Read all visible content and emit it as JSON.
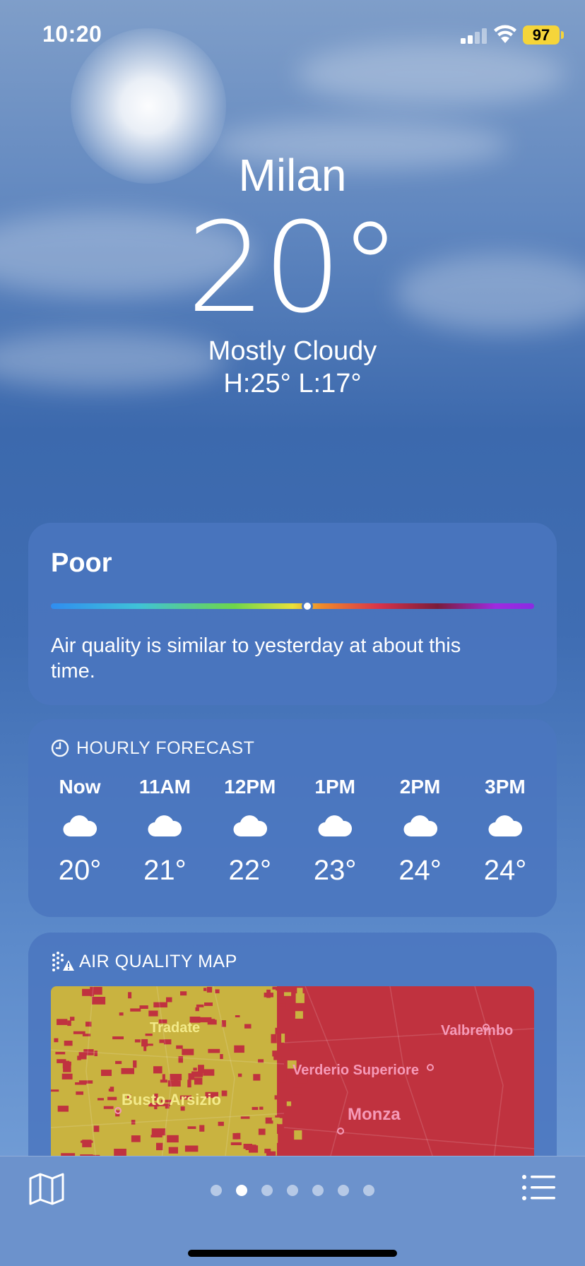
{
  "status_bar": {
    "time": "10:20",
    "battery": "97"
  },
  "hero": {
    "city": "Milan",
    "temperature": "20°",
    "condition": "Mostly Cloudy",
    "high_low": "H:25°  L:17°"
  },
  "air_quality": {
    "category": "Poor",
    "level_fraction": 0.53,
    "description": "Air quality is similar to yesterday at about this time."
  },
  "hourly_forecast": {
    "header": "HOURLY FORECAST",
    "icon": "clock-icon",
    "hours": [
      {
        "time": "Now",
        "icon": "cloud-icon",
        "temp": "20°"
      },
      {
        "time": "11AM",
        "icon": "cloud-icon",
        "temp": "21°"
      },
      {
        "time": "12PM",
        "icon": "cloud-icon",
        "temp": "22°"
      },
      {
        "time": "1PM",
        "icon": "cloud-icon",
        "temp": "23°"
      },
      {
        "time": "2PM",
        "icon": "cloud-icon",
        "temp": "24°"
      },
      {
        "time": "3PM",
        "icon": "cloud-icon",
        "temp": "24°"
      }
    ]
  },
  "air_quality_map": {
    "header": "AIR QUALITY MAP",
    "icon": "air-quality-warning-icon",
    "places": [
      "Tradate",
      "Valbrembo",
      "Verderio Superiore",
      "Busto Arsizio",
      "Monza"
    ],
    "colors": {
      "moderate": "#c9b340",
      "poor": "#c0323f"
    }
  },
  "bottom_bar": {
    "page_count": 7,
    "active_page": 2,
    "map_icon": "map-icon",
    "list_icon": "list-icon"
  }
}
